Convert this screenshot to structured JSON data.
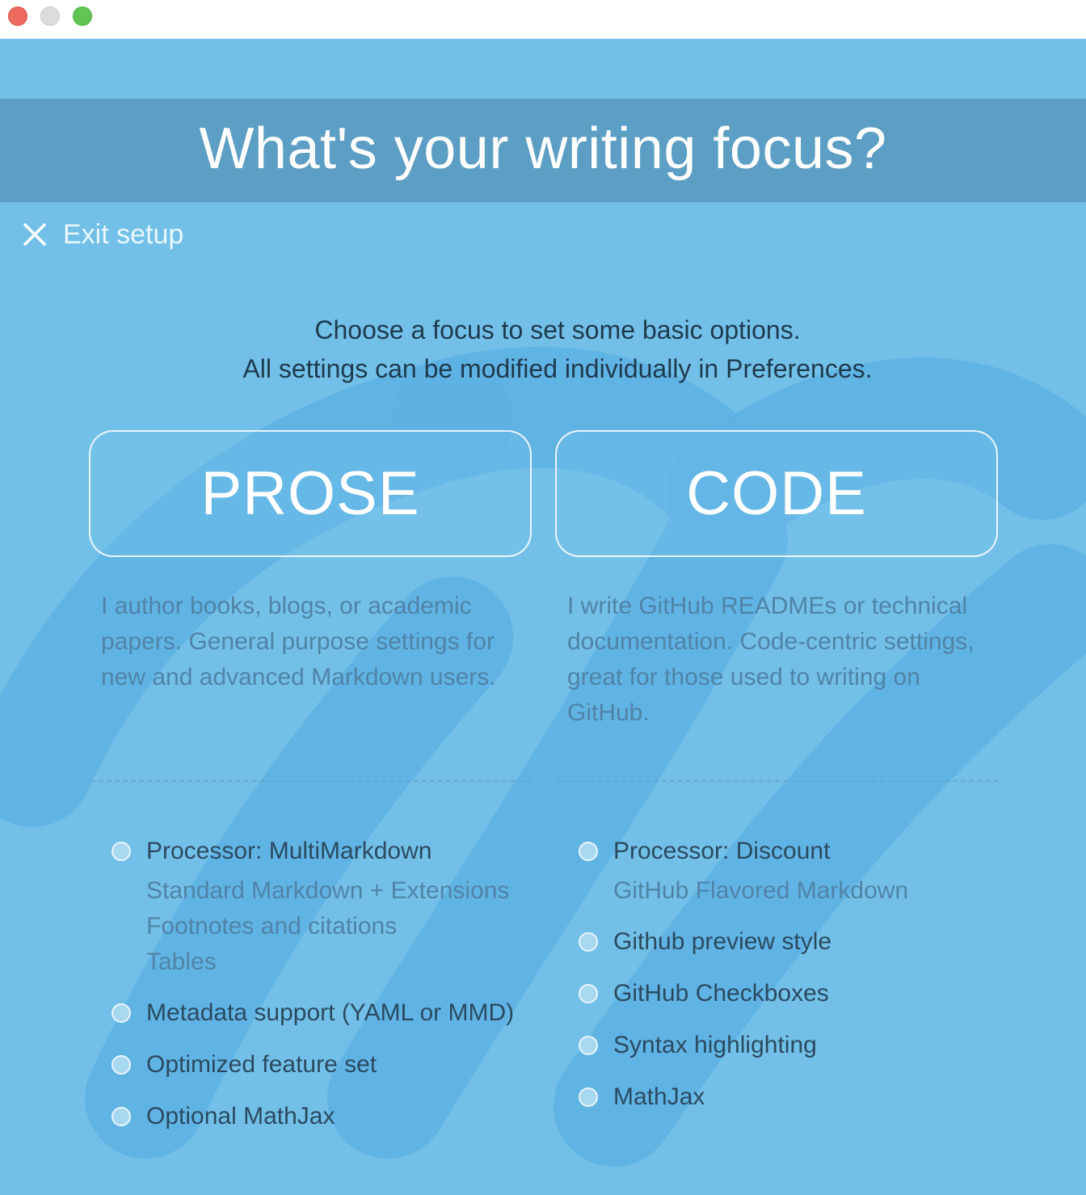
{
  "window": {
    "title_bar": {
      "controls": [
        "close",
        "minimize",
        "zoom"
      ]
    }
  },
  "header": {
    "title": "What's your writing focus?"
  },
  "exit": {
    "label": "Exit setup",
    "icon": "close-icon"
  },
  "intro": {
    "line1": "Choose a focus to set some basic options.",
    "line2": "All settings can be modified individually in Preferences."
  },
  "prose": {
    "button_label": "PROSE",
    "description": "I author books, blogs, or academic papers. General purpose settings for new and advanced Markdown users.",
    "features": [
      {
        "title": "Processor: MultiMarkdown",
        "subs": [
          "Standard Markdown + Extensions",
          "Footnotes and citations",
          "Tables"
        ]
      },
      {
        "title": "Metadata support (YAML or MMD)"
      },
      {
        "title": "Optimized feature set"
      },
      {
        "title": "Optional MathJax"
      }
    ]
  },
  "code": {
    "button_label": "CODE",
    "description": "I write GitHub READMEs or technical documentation. Code-centric settings, great for those used to writing on GitHub.",
    "features": [
      {
        "title": "Processor: Discount",
        "subs": [
          "GitHub Flavored Markdown"
        ]
      },
      {
        "title": "Github preview style"
      },
      {
        "title": "GitHub Checkboxes"
      },
      {
        "title": "Syntax highlighting"
      },
      {
        "title": "MathJax"
      }
    ]
  },
  "colors": {
    "background": "#72c0e8",
    "header_band": "#5c9ec4",
    "text_dark": "#1f3a4d",
    "text_muted": "#4f84a6"
  }
}
